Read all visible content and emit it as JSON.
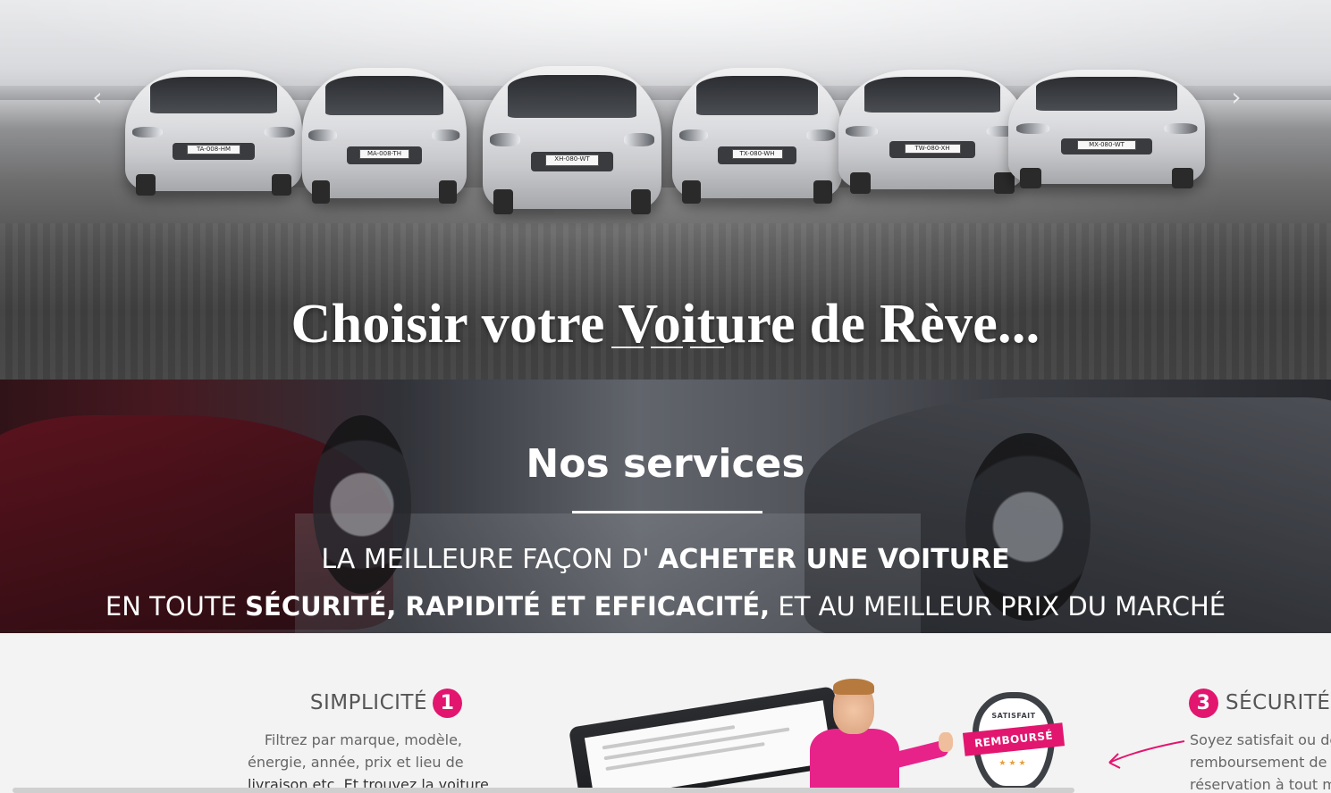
{
  "hero": {
    "title": "Choisir votre Voiture de Rève...",
    "plates": [
      "TA-008-HM",
      "MA-008-TH",
      "XH-080-WT",
      "TX-080-WH",
      "TW-080-XH",
      "MX-080-WT"
    ],
    "prev_icon": "chevron-left-icon",
    "next_icon": "chevron-right-icon"
  },
  "services": {
    "title": "Nos services",
    "line1_part1": "LA MEILLEURE FAÇON D'",
    "line1_bold": "ACHETER UNE VOITURE",
    "line2_part1": "EN TOUTE",
    "line2_bold": "SÉCURITÉ, RAPIDITÉ ET EFFICACITÉ,",
    "line2_part2": "ET AU MEILLEUR PRIX DU MARCHÉ"
  },
  "features": {
    "simplicite": {
      "title": "SIMPLICITÉ",
      "number": "1",
      "text_lines": [
        "Filtrez par marque, modèle,",
        "énergie, année, prix et lieu de",
        "livraison etc. Et trouvez la voiture"
      ]
    },
    "securite": {
      "title": "SÉCURITÉ",
      "number": "3",
      "text_lines": [
        "Soyez satisfait ou demandez un",
        "remboursement de votre",
        "réservation à tout moment"
      ]
    },
    "badge": {
      "top": "SATISFAIT",
      "ribbon": "REMBOURSÉ"
    }
  },
  "colors": {
    "accent": "#e2166f",
    "hero_text": "#ffffff",
    "features_bg": "#f3f3f3"
  }
}
